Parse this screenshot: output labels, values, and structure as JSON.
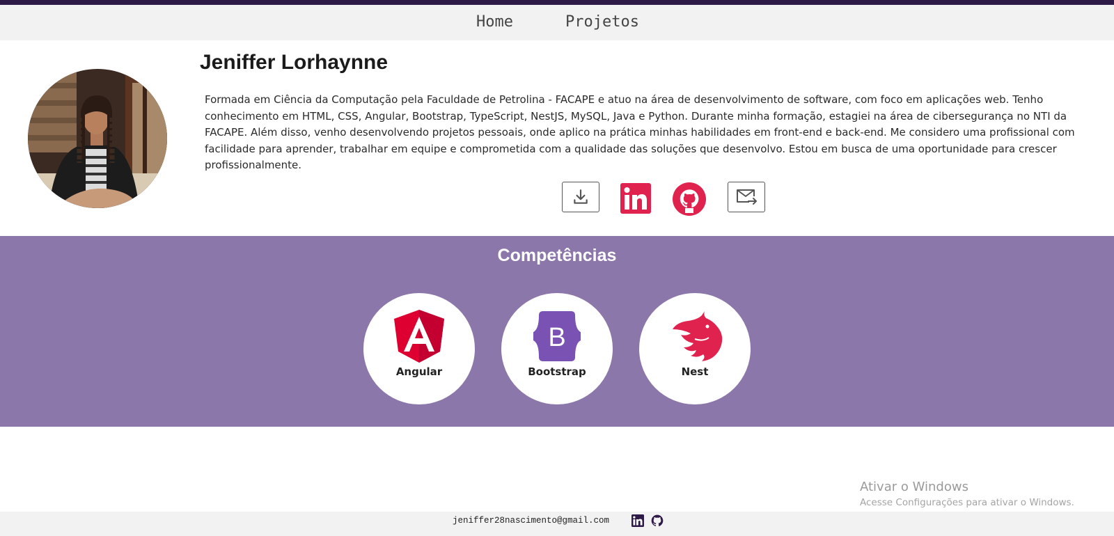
{
  "nav": {
    "items": [
      {
        "label": "Home"
      },
      {
        "label": "Projetos"
      }
    ]
  },
  "profile": {
    "name": "Jeniffer Lorhaynne",
    "bio": "Formada em Ciência da Computação pela Faculdade de Petrolina - FACAPE e atuo na área de desenvolvimento de software, com foco em aplicações web. Tenho conhecimento em HTML, CSS, Angular, Bootstrap, TypeScript, NestJS, MySQL, Java e Python. Durante minha formação, estagiei na área de cibersegurança no NTI da FACAPE. Além disso, venho desenvolvendo projetos pessoais, onde aplico na prática minhas habilidades em front-end e back-end. Me considero uma profissional com facilidade para aprender, trabalhar em equipe e comprometida com a qualidade das soluções que desenvolvo. Estou em busca de uma oportunidade para crescer profissionalmente."
  },
  "social": {
    "icons": [
      "download-icon",
      "linkedin-icon",
      "github-icon",
      "mail-forward-icon"
    ]
  },
  "skills": {
    "title": "Competências",
    "items": [
      {
        "label": "Angular",
        "icon": "angular-logo-icon"
      },
      {
        "label": "Bootstrap",
        "icon": "bootstrap-logo-icon"
      },
      {
        "label": "Nest",
        "icon": "nest-logo-icon"
      }
    ]
  },
  "watermark": {
    "title": "Ativar o Windows",
    "subtitle": "Acesse Configurações para ativar o Windows."
  },
  "footer": {
    "email": "jeniffer28nascimento@gmail.com"
  },
  "colors": {
    "topbar": "#2e1a47",
    "skills_bg": "#8c77aa",
    "accent_pink": "#e0234e",
    "bootstrap_purple": "#7952b3"
  }
}
